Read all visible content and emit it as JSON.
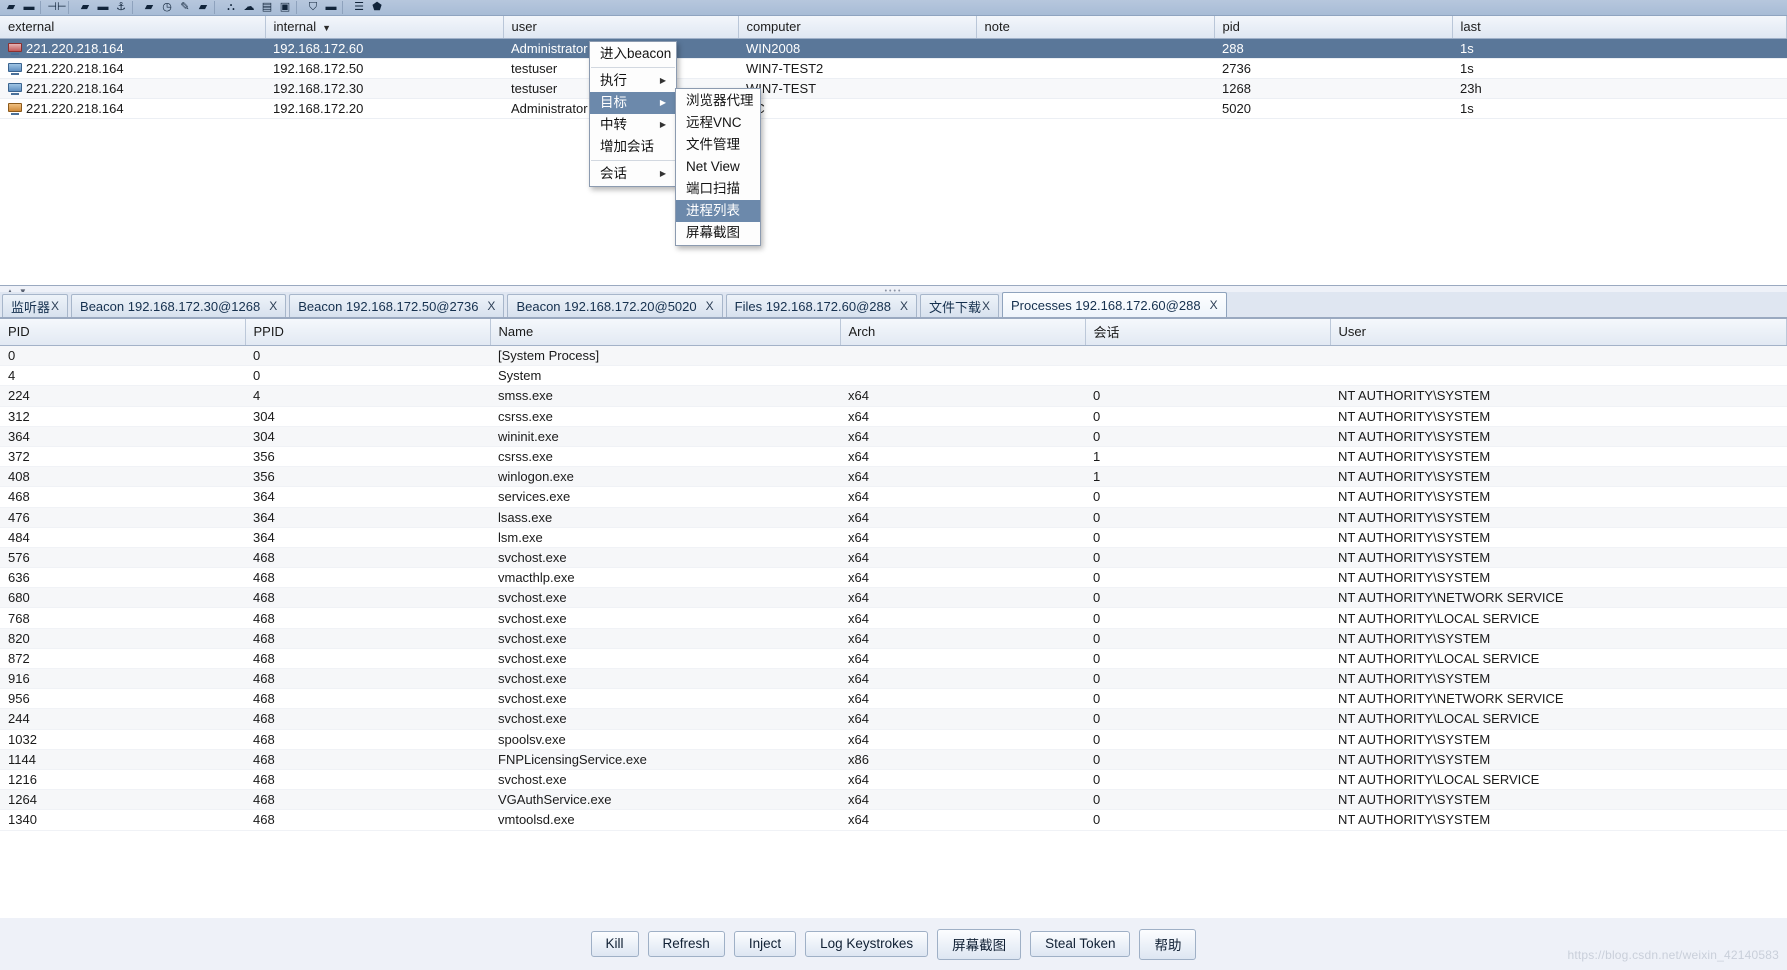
{
  "toolbar": {
    "icons": [
      "folder-open-icon",
      "save-icon",
      "separator",
      "filter-icon",
      "separator",
      "laptop-icon",
      "minimize-icon",
      "anchor-icon",
      "separator",
      "briefcase-icon",
      "clock-icon",
      "pencil-icon",
      "archive-icon",
      "separator",
      "cart-icon",
      "cloud-icon",
      "list-icon",
      "image-icon",
      "separator",
      "shield-icon",
      "bar-icon",
      "separator",
      "lines-icon",
      "shield2-icon"
    ]
  },
  "sessions": {
    "columns": [
      "external",
      "internal",
      "user",
      "computer",
      "note",
      "pid",
      "last"
    ],
    "sorted_column": "internal",
    "rows": [
      {
        "icon": "host-red-icon",
        "external": "221.220.218.164",
        "internal": "192.168.172.60",
        "user": "Administrator *",
        "computer": "WIN2008",
        "note": "",
        "pid": "288",
        "last": "1s",
        "selected": true
      },
      {
        "icon": "host-icon",
        "external": "221.220.218.164",
        "internal": "192.168.172.50",
        "user": "testuser",
        "computer": "WIN7-TEST2",
        "note": "",
        "pid": "2736",
        "last": "1s",
        "selected": false
      },
      {
        "icon": "host-icon",
        "external": "221.220.218.164",
        "internal": "192.168.172.30",
        "user": "testuser",
        "computer": "WIN7-TEST",
        "note": "",
        "pid": "1268",
        "last": "23h",
        "selected": false
      },
      {
        "icon": "host-win-icon",
        "external": "221.220.218.164",
        "internal": "192.168.172.20",
        "user": "Administrator *",
        "computer": "DC",
        "note": "",
        "pid": "5020",
        "last": "1s",
        "selected": false
      }
    ]
  },
  "context_menu": {
    "items": [
      {
        "label": "进入beacon",
        "submenu": false,
        "highlighted": false
      },
      {
        "label": "执行",
        "submenu": true,
        "highlighted": false
      },
      {
        "label": "目标",
        "submenu": true,
        "highlighted": true
      },
      {
        "label": "中转",
        "submenu": true,
        "highlighted": false
      },
      {
        "label": "增加会话",
        "submenu": false,
        "highlighted": false
      },
      {
        "label": "会话",
        "submenu": true,
        "highlighted": false
      }
    ],
    "submenu": {
      "items": [
        {
          "label": "浏览器代理",
          "highlighted": false
        },
        {
          "label": "远程VNC",
          "highlighted": false
        },
        {
          "label": "文件管理",
          "highlighted": false
        },
        {
          "label": "Net View",
          "highlighted": false
        },
        {
          "label": "端口扫描",
          "highlighted": false
        },
        {
          "label": "进程列表",
          "highlighted": true
        },
        {
          "label": "屏幕截图",
          "highlighted": false
        }
      ]
    }
  },
  "tabs": [
    {
      "label": "监听器",
      "close": "X",
      "active": false,
      "zh": true
    },
    {
      "label": "Beacon 192.168.172.30@1268",
      "close": "X",
      "active": false,
      "zh": false
    },
    {
      "label": "Beacon 192.168.172.50@2736",
      "close": "X",
      "active": false,
      "zh": false
    },
    {
      "label": "Beacon 192.168.172.20@5020",
      "close": "X",
      "active": false,
      "zh": false
    },
    {
      "label": "Files 192.168.172.60@288",
      "close": "X",
      "active": false,
      "zh": false
    },
    {
      "label": "文件下载",
      "close": "X",
      "active": false,
      "zh": true
    },
    {
      "label": "Processes 192.168.172.60@288",
      "close": "X",
      "active": true,
      "zh": false
    }
  ],
  "processes": {
    "columns": [
      "PID",
      "PPID",
      "Name",
      "Arch",
      "会话",
      "User"
    ],
    "rows": [
      {
        "pid": "0",
        "ppid": "0",
        "name": "[System Process]",
        "arch": "",
        "session": "",
        "user": ""
      },
      {
        "pid": "4",
        "ppid": "0",
        "name": "System",
        "arch": "",
        "session": "",
        "user": ""
      },
      {
        "pid": "224",
        "ppid": "4",
        "name": "smss.exe",
        "arch": "x64",
        "session": "0",
        "user": "NT AUTHORITY\\SYSTEM"
      },
      {
        "pid": "312",
        "ppid": "304",
        "name": "csrss.exe",
        "arch": "x64",
        "session": "0",
        "user": "NT AUTHORITY\\SYSTEM"
      },
      {
        "pid": "364",
        "ppid": "304",
        "name": "wininit.exe",
        "arch": "x64",
        "session": "0",
        "user": "NT AUTHORITY\\SYSTEM"
      },
      {
        "pid": "372",
        "ppid": "356",
        "name": "csrss.exe",
        "arch": "x64",
        "session": "1",
        "user": "NT AUTHORITY\\SYSTEM"
      },
      {
        "pid": "408",
        "ppid": "356",
        "name": "winlogon.exe",
        "arch": "x64",
        "session": "1",
        "user": "NT AUTHORITY\\SYSTEM"
      },
      {
        "pid": "468",
        "ppid": "364",
        "name": "services.exe",
        "arch": "x64",
        "session": "0",
        "user": "NT AUTHORITY\\SYSTEM"
      },
      {
        "pid": "476",
        "ppid": "364",
        "name": "lsass.exe",
        "arch": "x64",
        "session": "0",
        "user": "NT AUTHORITY\\SYSTEM"
      },
      {
        "pid": "484",
        "ppid": "364",
        "name": "lsm.exe",
        "arch": "x64",
        "session": "0",
        "user": "NT AUTHORITY\\SYSTEM"
      },
      {
        "pid": "576",
        "ppid": "468",
        "name": "svchost.exe",
        "arch": "x64",
        "session": "0",
        "user": "NT AUTHORITY\\SYSTEM"
      },
      {
        "pid": "636",
        "ppid": "468",
        "name": "vmacthlp.exe",
        "arch": "x64",
        "session": "0",
        "user": "NT AUTHORITY\\SYSTEM"
      },
      {
        "pid": "680",
        "ppid": "468",
        "name": "svchost.exe",
        "arch": "x64",
        "session": "0",
        "user": "NT AUTHORITY\\NETWORK SERVICE"
      },
      {
        "pid": "768",
        "ppid": "468",
        "name": "svchost.exe",
        "arch": "x64",
        "session": "0",
        "user": "NT AUTHORITY\\LOCAL SERVICE"
      },
      {
        "pid": "820",
        "ppid": "468",
        "name": "svchost.exe",
        "arch": "x64",
        "session": "0",
        "user": "NT AUTHORITY\\SYSTEM"
      },
      {
        "pid": "872",
        "ppid": "468",
        "name": "svchost.exe",
        "arch": "x64",
        "session": "0",
        "user": "NT AUTHORITY\\LOCAL SERVICE"
      },
      {
        "pid": "916",
        "ppid": "468",
        "name": "svchost.exe",
        "arch": "x64",
        "session": "0",
        "user": "NT AUTHORITY\\SYSTEM"
      },
      {
        "pid": "956",
        "ppid": "468",
        "name": "svchost.exe",
        "arch": "x64",
        "session": "0",
        "user": "NT AUTHORITY\\NETWORK SERVICE"
      },
      {
        "pid": "244",
        "ppid": "468",
        "name": "svchost.exe",
        "arch": "x64",
        "session": "0",
        "user": "NT AUTHORITY\\LOCAL SERVICE"
      },
      {
        "pid": "1032",
        "ppid": "468",
        "name": "spoolsv.exe",
        "arch": "x64",
        "session": "0",
        "user": "NT AUTHORITY\\SYSTEM"
      },
      {
        "pid": "1144",
        "ppid": "468",
        "name": "FNPLicensingService.exe",
        "arch": "x86",
        "session": "0",
        "user": "NT AUTHORITY\\SYSTEM"
      },
      {
        "pid": "1216",
        "ppid": "468",
        "name": "svchost.exe",
        "arch": "x64",
        "session": "0",
        "user": "NT AUTHORITY\\LOCAL SERVICE"
      },
      {
        "pid": "1264",
        "ppid": "468",
        "name": "VGAuthService.exe",
        "arch": "x64",
        "session": "0",
        "user": "NT AUTHORITY\\SYSTEM"
      },
      {
        "pid": "1340",
        "ppid": "468",
        "name": "vmtoolsd.exe",
        "arch": "x64",
        "session": "0",
        "user": "NT AUTHORITY\\SYSTEM"
      }
    ]
  },
  "buttons": [
    {
      "label": "Kill"
    },
    {
      "label": "Refresh"
    },
    {
      "label": "Inject"
    },
    {
      "label": "Log Keystrokes"
    },
    {
      "label": "屏幕截图"
    },
    {
      "label": "Steal Token"
    },
    {
      "label": "帮助"
    }
  ],
  "watermark": "https://blog.csdn.net/weixin_42140583"
}
